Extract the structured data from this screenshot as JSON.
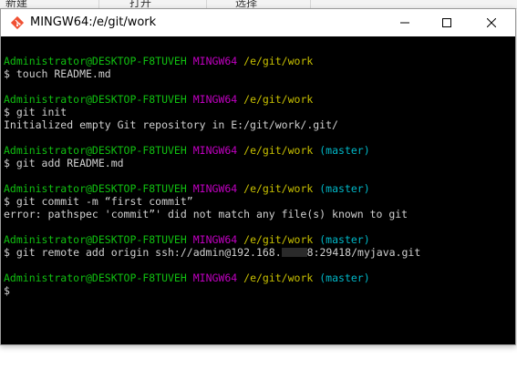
{
  "background_window": {
    "labels": [
      "新建",
      "打开",
      "选择"
    ]
  },
  "window": {
    "title": "MINGW64:/e/git/work",
    "icon": "git-diamond-icon",
    "buttons": {
      "minimize": "minimize-icon",
      "maximize": "maximize-icon",
      "close": "close-icon"
    }
  },
  "colors": {
    "user": "#10c010",
    "host": "#c000c0",
    "path": "#c8c000",
    "branch": "#00b8c8",
    "output": "#d0d0d0",
    "terminal_bg": "#000000"
  },
  "terminal": {
    "blocks": [
      {
        "prompt": {
          "user": "Administrator@DESKTOP-F8TUVEH",
          "host": "MINGW64",
          "path": "/e/git/work",
          "branch": ""
        },
        "command": "$ touch README.md",
        "output": []
      },
      {
        "prompt": {
          "user": "Administrator@DESKTOP-F8TUVEH",
          "host": "MINGW64",
          "path": "/e/git/work",
          "branch": ""
        },
        "command": "$ git init",
        "output": [
          "Initialized empty Git repository in E:/git/work/.git/"
        ]
      },
      {
        "prompt": {
          "user": "Administrator@DESKTOP-F8TUVEH",
          "host": "MINGW64",
          "path": "/e/git/work",
          "branch": "(master)"
        },
        "command": "$ git add README.md",
        "output": []
      },
      {
        "prompt": {
          "user": "Administrator@DESKTOP-F8TUVEH",
          "host": "MINGW64",
          "path": "/e/git/work",
          "branch": "(master)"
        },
        "command": "$ git commit -m “first commit”",
        "output": [
          "error: pathspec 'commit”' did not match any file(s) known to git"
        ]
      },
      {
        "prompt": {
          "user": "Administrator@DESKTOP-F8TUVEH",
          "host": "MINGW64",
          "path": "/e/git/work",
          "branch": "(master)"
        },
        "command_before_redaction": "$ git remote add origin ssh://admin@192.168.",
        "command_after_redaction": "8:29418/myjava.git",
        "output": []
      },
      {
        "prompt": {
          "user": "Administrator@DESKTOP-F8TUVEH",
          "host": "MINGW64",
          "path": "/e/git/work",
          "branch": "(master)"
        },
        "command": "$",
        "output": []
      }
    ]
  }
}
